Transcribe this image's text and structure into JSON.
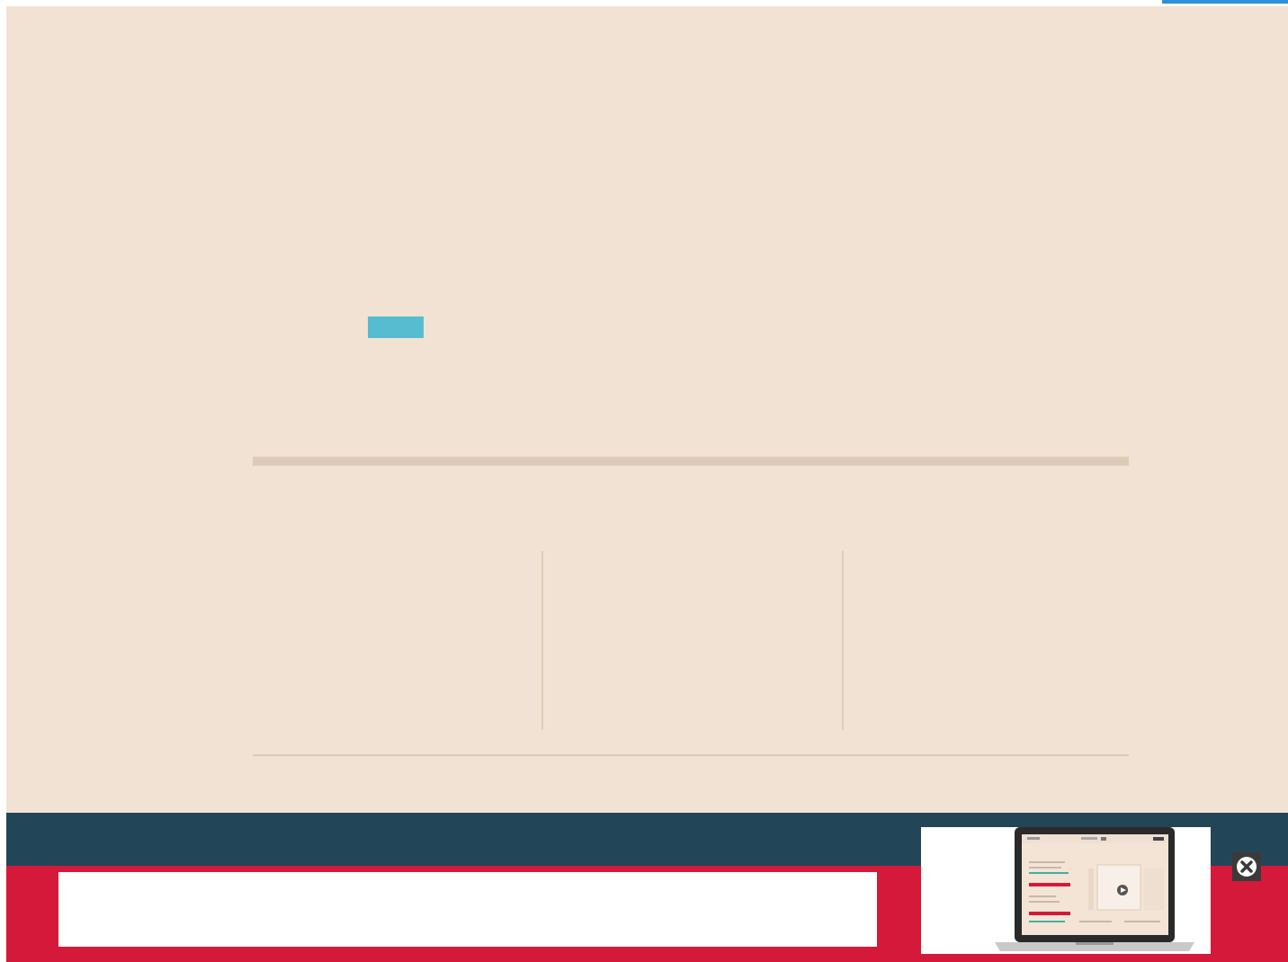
{
  "page": {
    "background": "#f2e2d3"
  },
  "main": {
    "accent_button": {
      "label": "",
      "color": "#56bdd1"
    }
  },
  "banner": {
    "top_band_color": "#234558",
    "bottom_band_color": "#d4193a",
    "input": {
      "value": "",
      "placeholder": ""
    },
    "promo_image": {
      "icon": "laptop-screenshot-image"
    },
    "close": {
      "icon": "close-icon"
    }
  },
  "top_tab": {
    "color": "#2f8fd8"
  }
}
